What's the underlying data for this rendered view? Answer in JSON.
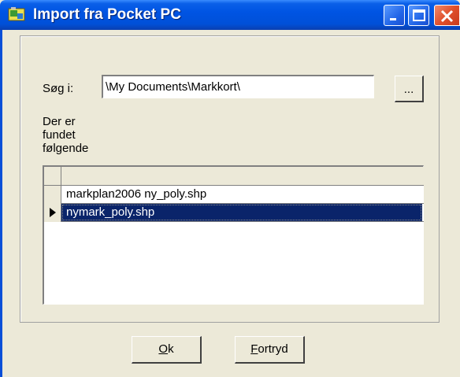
{
  "window": {
    "title": "Import fra Pocket PC",
    "controls": {
      "minimize": "minimize",
      "maximize": "maximize",
      "close": "close"
    }
  },
  "search": {
    "label": "Søg i:",
    "path_value": "\\My Documents\\Markkort\\",
    "browse_label": "..."
  },
  "found_label": "Der er fundet følgende",
  "files": [
    {
      "name": "markplan2006 ny_poly.shp",
      "selected": false
    },
    {
      "name": "nymark_poly.shp",
      "selected": true
    }
  ],
  "buttons": {
    "ok": "Ok",
    "cancel": "Fortryd"
  },
  "colors": {
    "titlebar": "#0054e3",
    "selection": "#0a246a",
    "face": "#ece9d8",
    "close": "#e0502c"
  }
}
